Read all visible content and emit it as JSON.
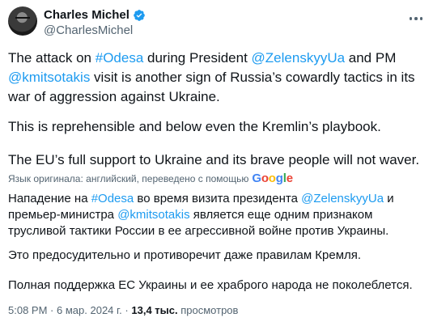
{
  "author": {
    "name": "Charles Michel",
    "handle": "@CharlesMichel",
    "verified": true
  },
  "tweet": {
    "p1": {
      "t1": "The attack on ",
      "hashtag": "#Odesa",
      "t2": " during President ",
      "mention1": "@ZelenskyyUa",
      "t3": " and PM ",
      "mention2": "@kmitsotakis",
      "t4": " visit is another sign of Russia’s cowardly tactics in its war of aggression against Ukraine."
    },
    "p2": "This is reprehensible and below even the Kremlin’s playbook.",
    "p3": "The EU’s full support to Ukraine and its brave people will not waver."
  },
  "translation": {
    "note": "Язык оригинала: английский, переведено с помощью",
    "provider": "Google",
    "p1": {
      "t1": "Нападение на ",
      "hashtag": "#Odesa",
      "t2": " во время визита президента ",
      "mention1": "@ZelenskyyUa",
      "t3": " и премьер-министра ",
      "mention2": "@kmitsotakis",
      "t4": " является еще одним признаком трусливой тактики России в ее агрессивной войне против Украины."
    },
    "p2": "Это предосудительно и противоречит даже правилам Кремля.",
    "p3": "Полная поддержка ЕС Украины и ее храброго народа не поколеблется."
  },
  "meta": {
    "time": "5:08 PM",
    "sep": "·",
    "date": "6 мар. 2024 г.",
    "views_count": "13,4 тыс.",
    "views_label": "просмотров"
  },
  "colors": {
    "link": "#1d9bf0",
    "secondary_text": "#536471",
    "verified": "#1d9bf0"
  },
  "icons": [
    "avatar",
    "verified-badge-icon",
    "more-options-icon"
  ]
}
